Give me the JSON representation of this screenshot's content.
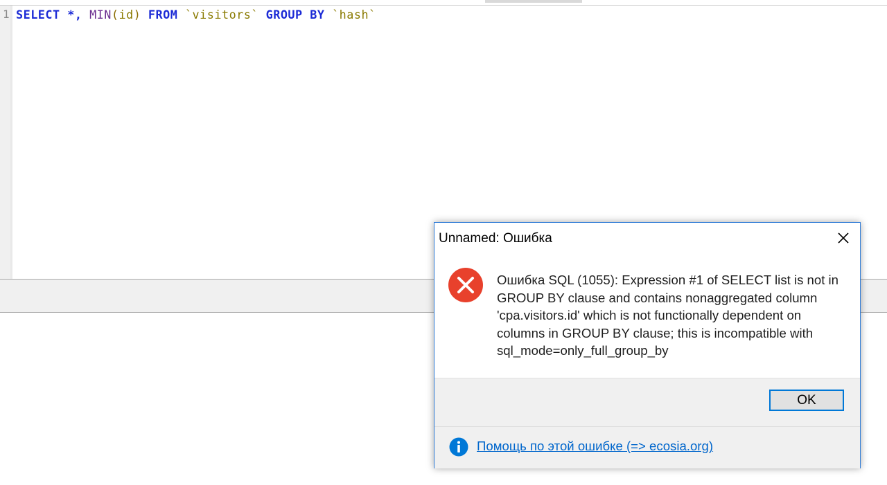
{
  "editor": {
    "line_number": "1",
    "tokens": {
      "select": "SELECT",
      "star_comma": "*,",
      "min": "MIN",
      "open_paren": "(",
      "id": "id",
      "close_paren": ")",
      "from": "FROM",
      "table": "`visitors`",
      "group": "GROUP",
      "by": "BY",
      "column": "`hash`"
    }
  },
  "dialog": {
    "title": "Unnamed: Ошибка",
    "message": "Ошибка SQL (1055): Expression #1 of SELECT list is not in GROUP BY clause and contains nonaggregated column 'cpa.visitors.id' which is not functionally dependent on columns in GROUP BY clause; this is incompatible with sql_mode=only_full_group_by",
    "ok_label": "OK",
    "help_link": "Помощь по этой ошибке (=> ecosia.org)",
    "icons": {
      "error": "error-icon",
      "info": "info-icon",
      "close": "close-icon"
    }
  },
  "colors": {
    "sql_keyword": "#1c2bd6",
    "error_red": "#e8412c",
    "info_blue": "#0078d7",
    "link": "#0066cc",
    "dialog_border": "#2f7bd6"
  }
}
